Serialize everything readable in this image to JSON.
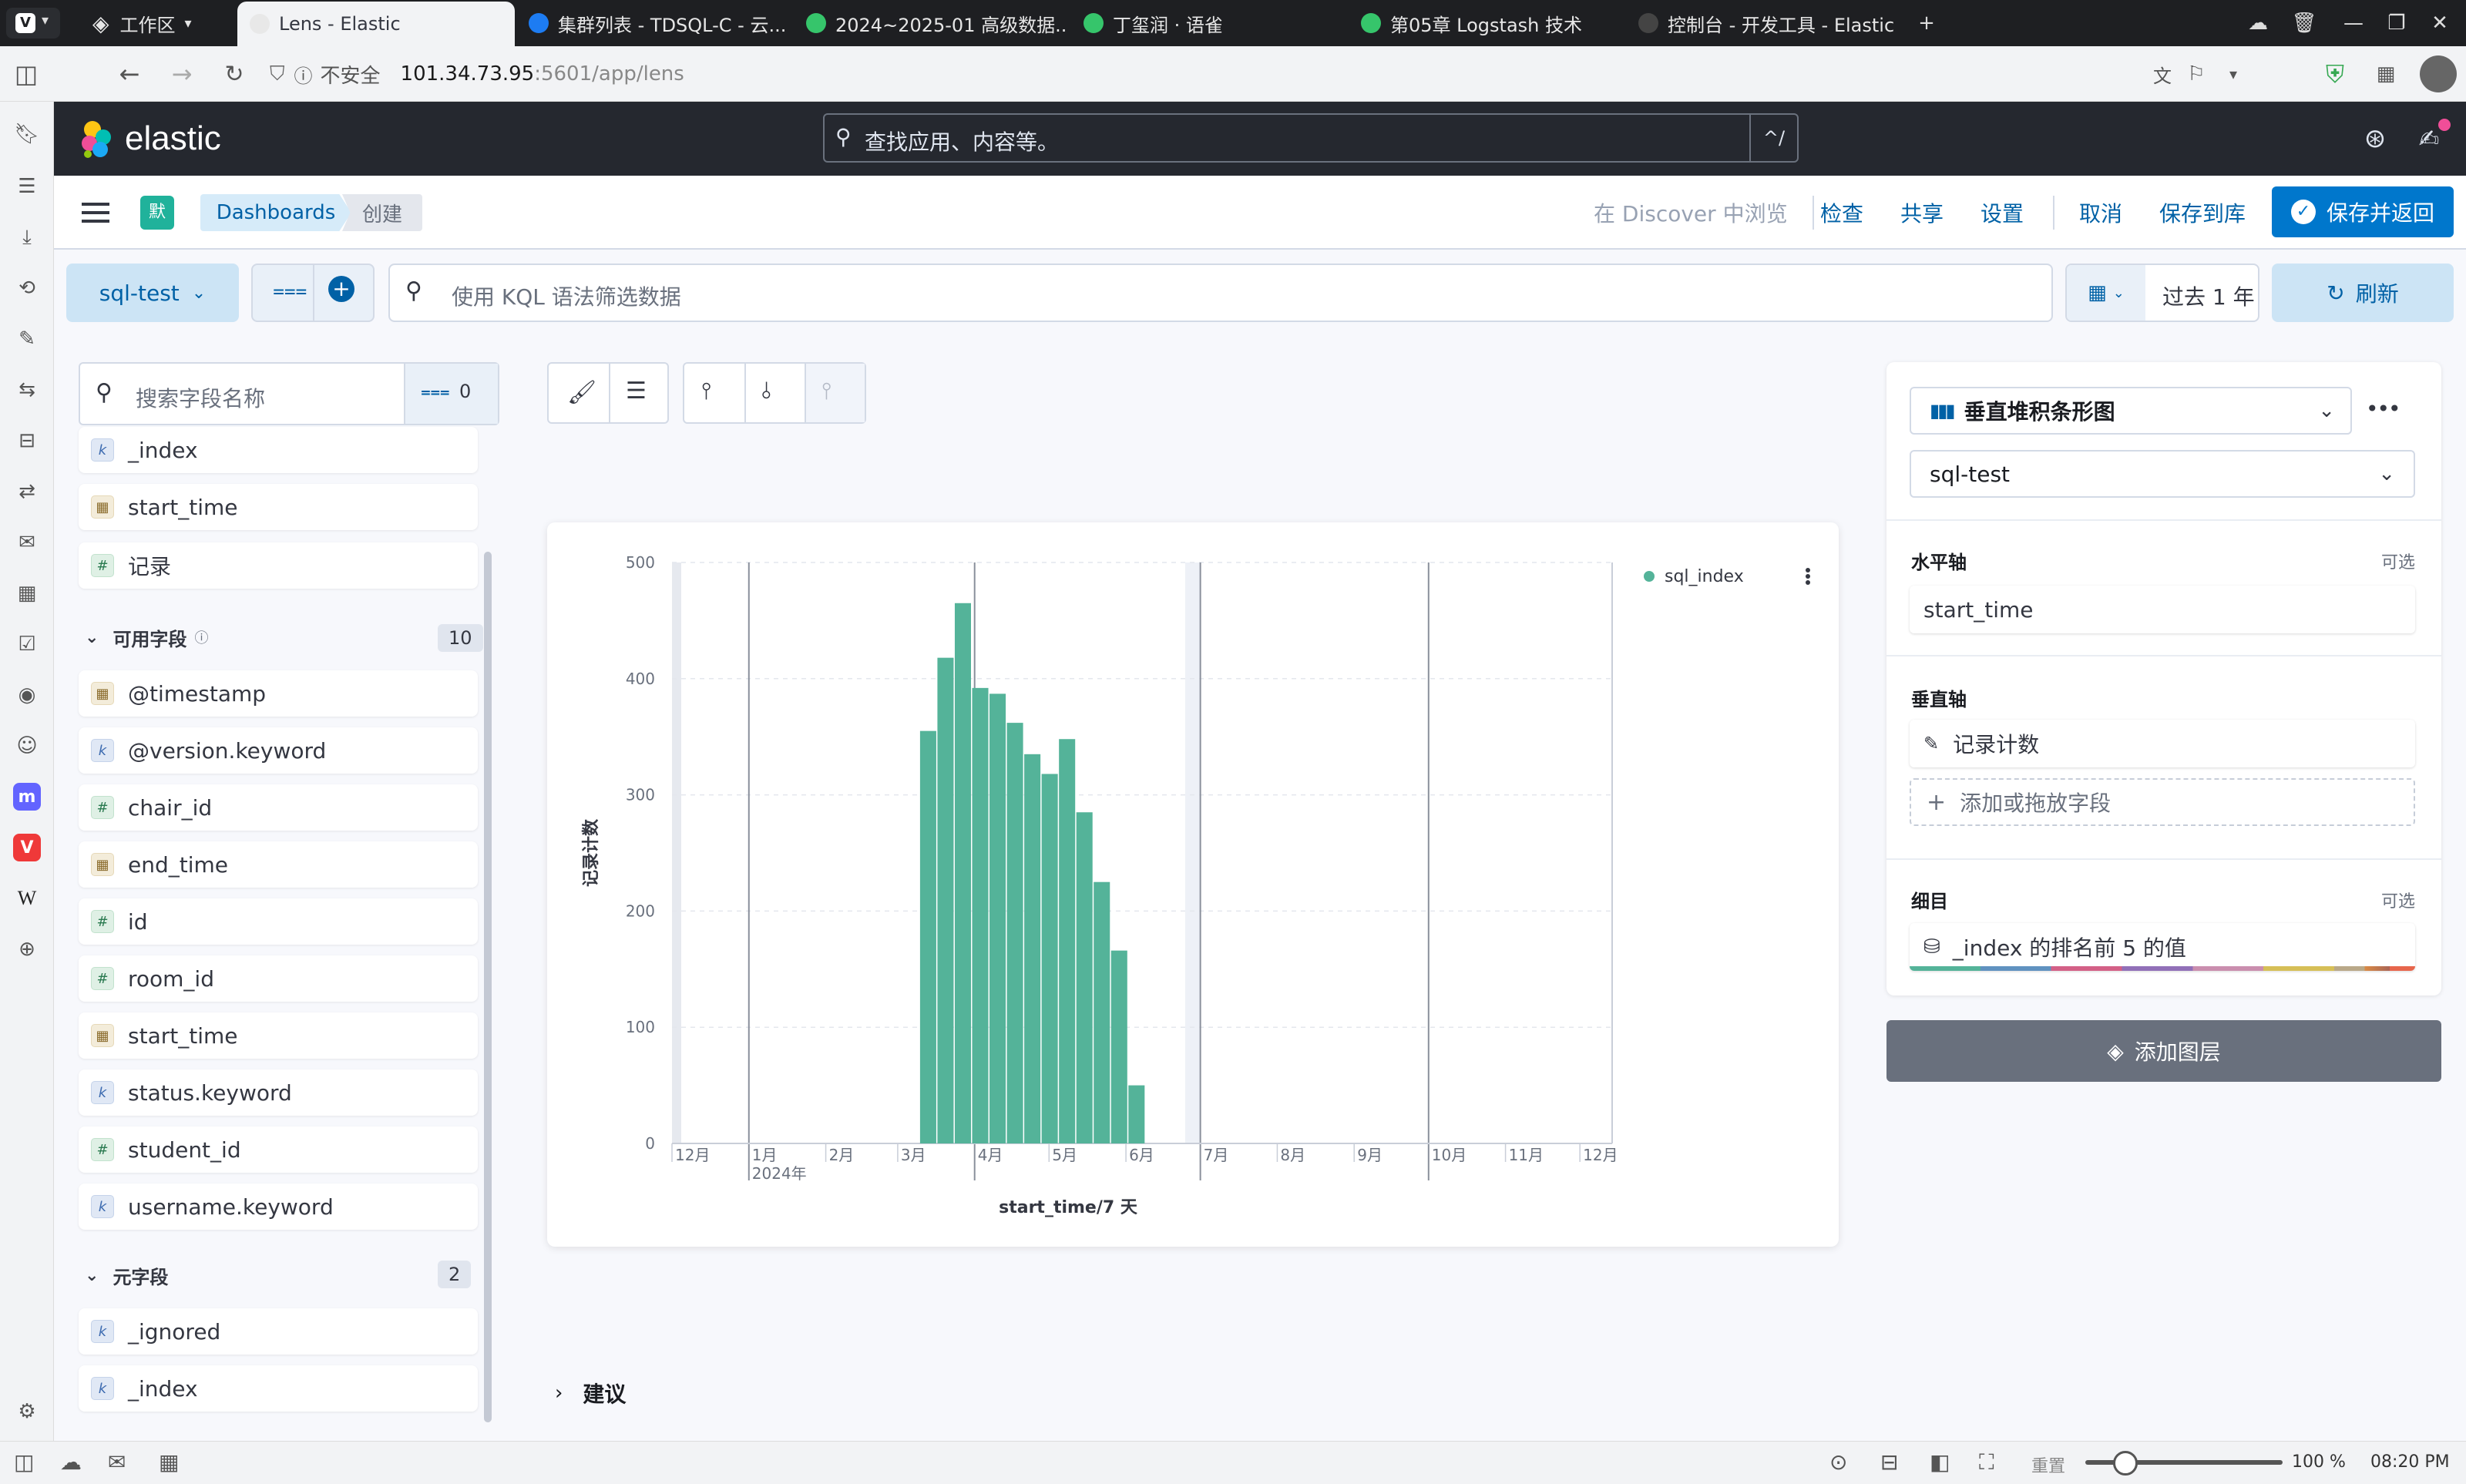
{
  "browser": {
    "workspace_label": "工作区",
    "tabs": [
      {
        "title": "Lens - Elastic",
        "color": "#e8e8e8"
      },
      {
        "title": "集群列表 - TDSQL-C - 云...",
        "color": "#1d7cf2"
      },
      {
        "title": "2024~2025-01 高级数据...",
        "color": "#36c56b"
      },
      {
        "title": "丁玺润 · 语雀",
        "color": "#36c56b"
      },
      {
        "title": "第05章 Logstash 技术",
        "color": "#36c56b"
      },
      {
        "title": "控制台 - 开发工具 - Elastic",
        "color": "#444"
      }
    ],
    "insecure_label": "不安全",
    "url_host": "101.34.73.95",
    "url_rest": ":5601/app/lens"
  },
  "elastic": {
    "brand": "elastic",
    "search_placeholder": "查找应用、内容等。",
    "search_shortcut": "^/"
  },
  "appbar": {
    "space_badge": "默",
    "breadcrumb_dashboards": "Dashboards",
    "breadcrumb_current": "创建",
    "discover_link": "在 Discover 中浏览",
    "inspect": "检查",
    "share": "共享",
    "settings": "设置",
    "cancel": "取消",
    "save_to_library": "保存到库",
    "save_and_return": "保存并返回"
  },
  "querybar": {
    "dataview": "sql-test",
    "kql_placeholder": "使用 KQL 语法筛选数据",
    "time_range": "过去 1 年",
    "refresh": "刷新"
  },
  "fields": {
    "search_placeholder": "搜索字段名称",
    "filter_count": "0",
    "top_fields": [
      {
        "name": "_index",
        "type": "k"
      },
      {
        "name": "start_time",
        "type": "d"
      },
      {
        "name": "记录",
        "type": "n"
      }
    ],
    "available_label": "可用字段",
    "available_count": "10",
    "available": [
      {
        "name": "@timestamp",
        "type": "d"
      },
      {
        "name": "@version.keyword",
        "type": "k"
      },
      {
        "name": "chair_id",
        "type": "n"
      },
      {
        "name": "end_time",
        "type": "d"
      },
      {
        "name": "id",
        "type": "n"
      },
      {
        "name": "room_id",
        "type": "n"
      },
      {
        "name": "start_time",
        "type": "d"
      },
      {
        "name": "status.keyword",
        "type": "k"
      },
      {
        "name": "student_id",
        "type": "n"
      },
      {
        "name": "username.keyword",
        "type": "k"
      }
    ],
    "meta_label": "元字段",
    "meta_count": "2",
    "meta": [
      {
        "name": "_ignored",
        "type": "k"
      },
      {
        "name": "_index",
        "type": "k"
      }
    ]
  },
  "suggestions_label": "建议",
  "chart_data": {
    "type": "bar",
    "title": "",
    "xlabel": "start_time/7 天",
    "ylabel": "记录计数",
    "ylim": [
      0,
      500
    ],
    "y_ticks": [
      0,
      100,
      200,
      300,
      400,
      500
    ],
    "x_tick_labels": [
      "12月",
      "1月",
      "2月",
      "3月",
      "4月",
      "5月",
      "6月",
      "7月",
      "8月",
      "9月",
      "10月",
      "11月",
      "12月"
    ],
    "x_year_label": "2024年",
    "legend": "top-right",
    "series": [
      {
        "name": "sql_index",
        "color": "#54b399",
        "x": [
          "2024-03-10",
          "2024-03-17",
          "2024-03-24",
          "2024-03-31",
          "2024-04-07",
          "2024-04-14",
          "2024-04-21",
          "2024-04-28",
          "2024-05-05",
          "2024-05-12",
          "2024-05-19",
          "2024-05-26",
          "2024-06-02",
          "2024-06-09",
          "2024-06-16"
        ],
        "values": [
          355,
          418,
          465,
          392,
          387,
          362,
          335,
          318,
          348,
          285,
          225,
          166,
          50,
          0,
          0
        ]
      }
    ]
  },
  "config": {
    "chart_type": "垂直堆积条形图",
    "dataview": "sql-test",
    "x_axis_title": "水平轴",
    "optional": "可选",
    "x_axis_field": "start_time",
    "y_axis_title": "垂直轴",
    "y_axis_field": "记录计数",
    "add_field": "添加或拖放字段",
    "breakdown_title": "细目",
    "breakdown_field": "_index 的排名前 5 的值",
    "add_layer": "添加图层"
  },
  "status": {
    "reset": "重置",
    "zoom": "100 %",
    "time": "08:20 PM"
  }
}
